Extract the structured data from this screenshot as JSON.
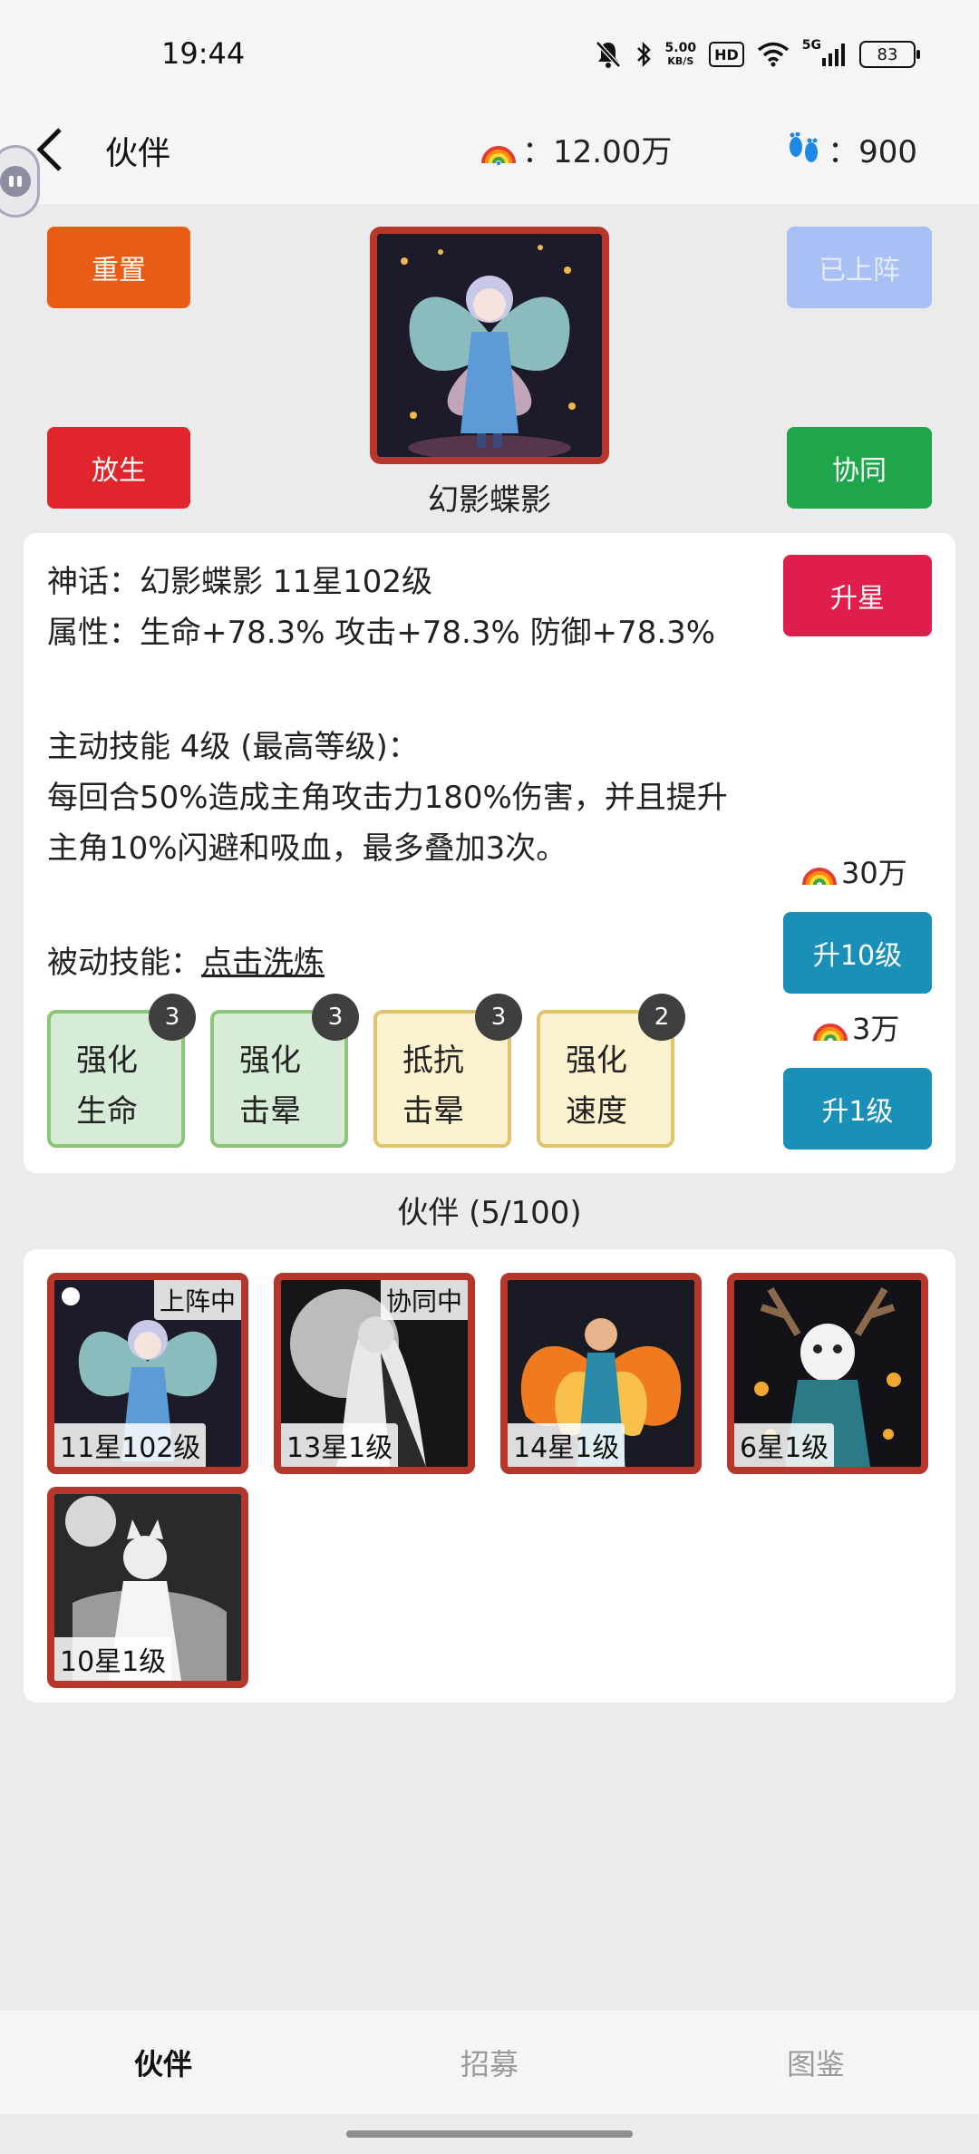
{
  "status_bar": {
    "time": "19:44",
    "net_speed_value": "5.00",
    "net_speed_unit": "KB/S",
    "hd": "HD",
    "signal": "5G",
    "battery": "83"
  },
  "header": {
    "title": "伙伴",
    "currency_label": "：12.00万",
    "steps_label": "：900"
  },
  "buttons": {
    "reset": "重置",
    "release": "放生",
    "deployed": "已上阵",
    "sync": "协同",
    "star_up": "升星",
    "level_up_10": "升10级",
    "level_up_1": "升1级"
  },
  "hero": {
    "name": "幻影蝶影"
  },
  "info": {
    "line1": "神话：幻影蝶影  11星102级",
    "line2": "属性：生命+78.3% 攻击+78.3% 防御+78.3%",
    "active_title": "主动技能 4级 (最高等级)：",
    "active_desc1": "每回合50%造成主角攻击力180%伤害，并且提升",
    "active_desc2": "主角10%闪避和吸血，最多叠加3次。",
    "passive_label": "被动技能：",
    "passive_link": "点击洗炼",
    "cost_10": "30万",
    "cost_1": "3万"
  },
  "skills": [
    {
      "line1": "强化",
      "line2": "生命",
      "level": "3",
      "color": "#d6ecd6"
    },
    {
      "line1": "强化",
      "line2": "击晕",
      "level": "3",
      "color": "#d6ecd6"
    },
    {
      "line1": "抵抗",
      "line2": "击晕",
      "level": "3",
      "color": "#fdf2cf"
    },
    {
      "line1": "强化",
      "line2": "速度",
      "level": "2",
      "color": "#fdf2cf"
    }
  ],
  "partners": {
    "title": "伙伴 (5/100)",
    "items": [
      {
        "tag": "上阵中",
        "level": "11星102级"
      },
      {
        "tag": "协同中",
        "level": "13星1级"
      },
      {
        "tag": "",
        "level": "14星1级"
      },
      {
        "tag": "",
        "level": "6星1级"
      },
      {
        "tag": "",
        "level": "10星1级"
      }
    ]
  },
  "bottom_nav": {
    "partner": "伙伴",
    "recruit": "招募",
    "codex": "图鉴"
  }
}
